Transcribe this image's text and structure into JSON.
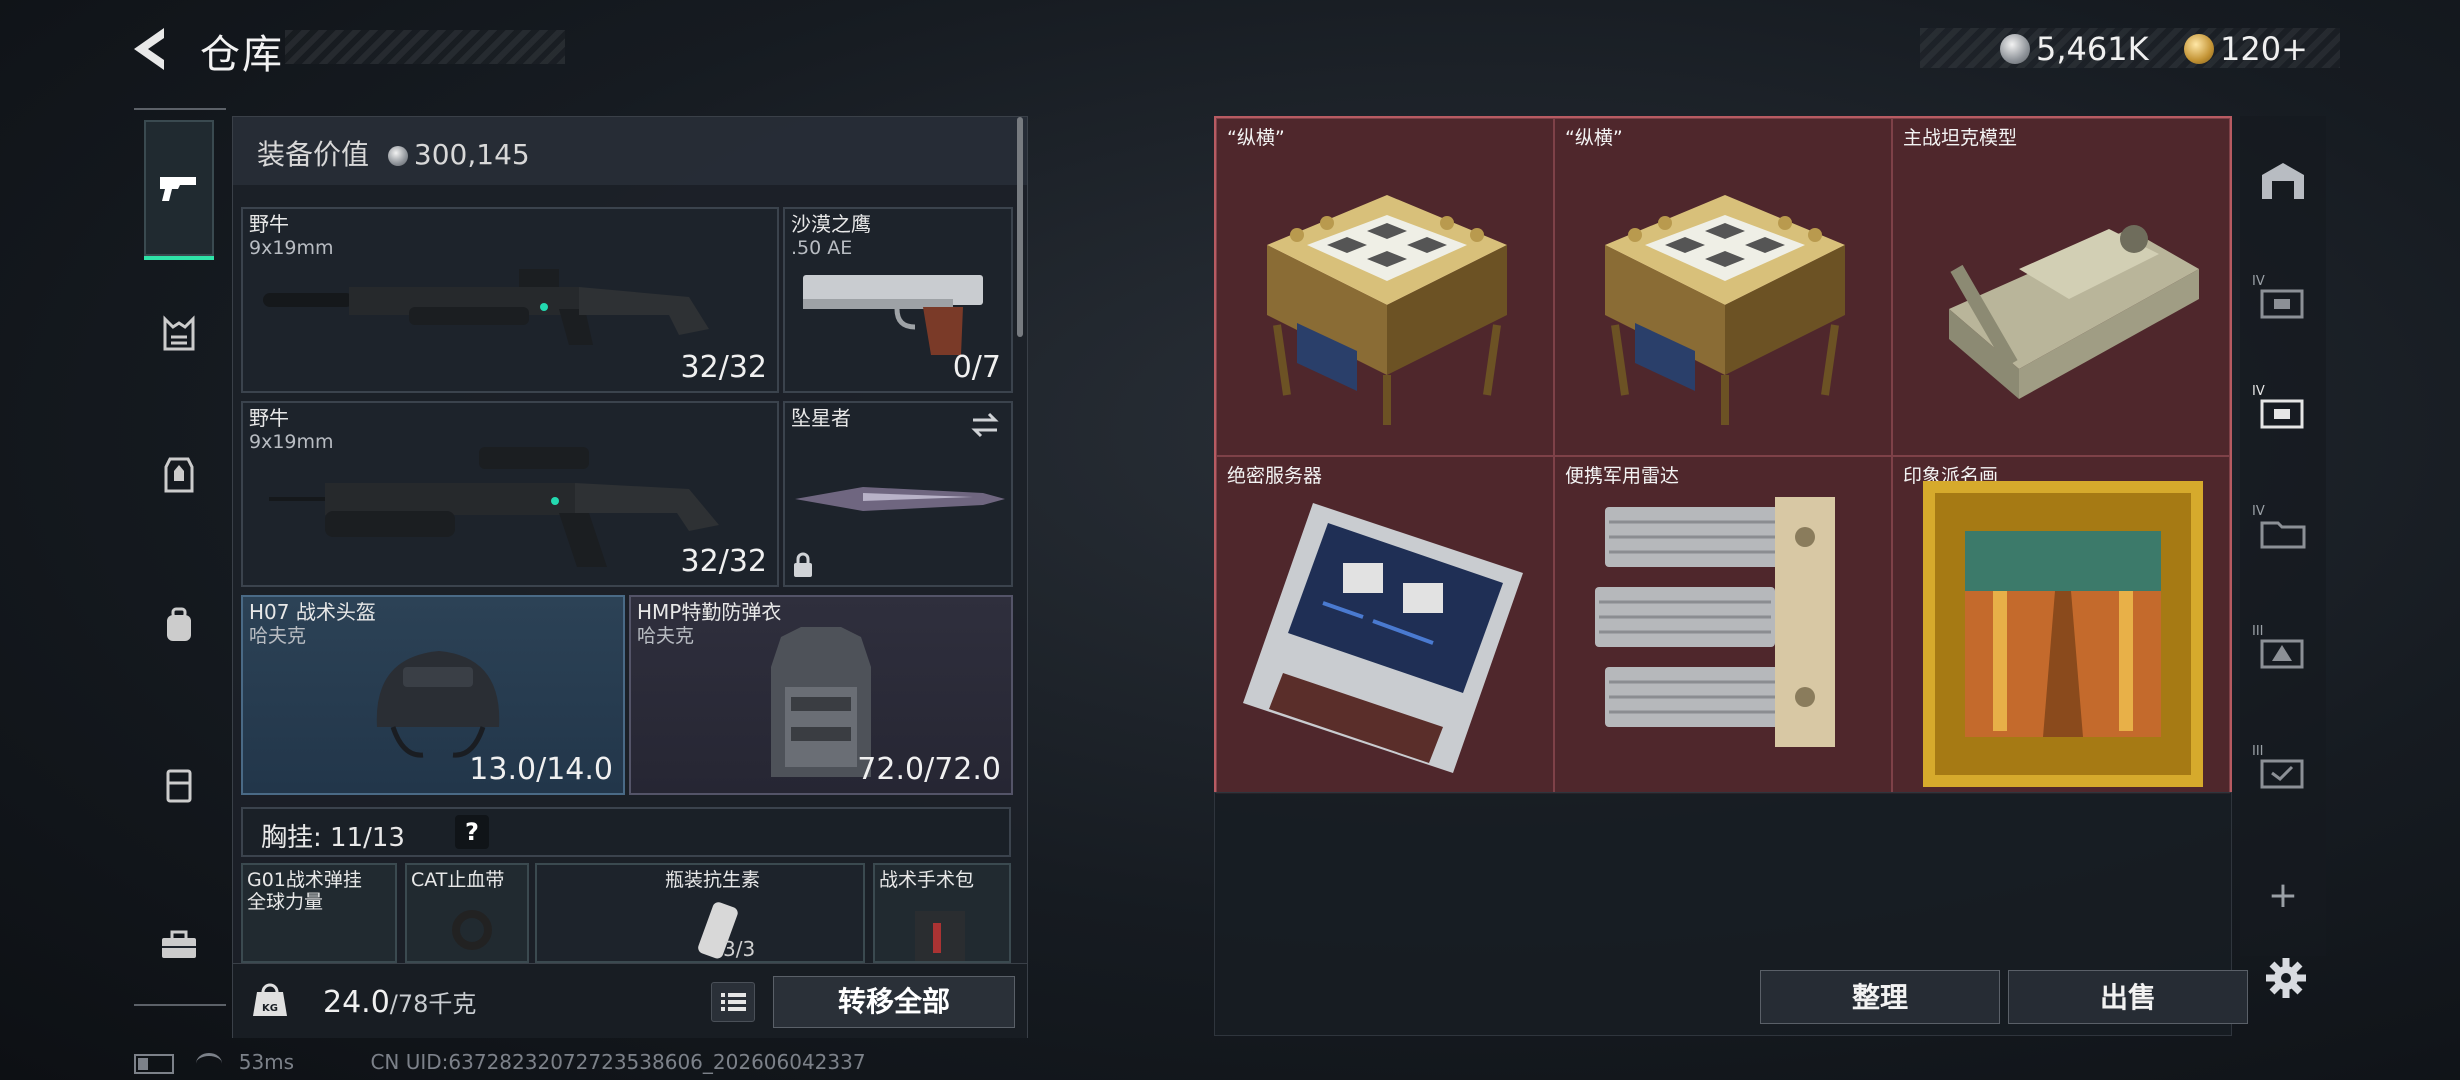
{
  "header": {
    "title": "仓库"
  },
  "currency": {
    "silver": "5,461K",
    "gold": "120+"
  },
  "equipment": {
    "value_label": "装备价值",
    "value": "300,145",
    "slots": [
      {
        "name": "野牛",
        "sub": "9x19mm",
        "count": "32/32"
      },
      {
        "name": "沙漠之鹰",
        "sub": ".50 AE",
        "count": "0/7"
      },
      {
        "name": "野牛",
        "sub": "9x19mm",
        "count": "32/32"
      },
      {
        "name": "坠星者",
        "sub": "",
        "count": ""
      },
      {
        "name": "H07 战术头盔",
        "sub": "哈夫克",
        "count": "13.0/14.0"
      },
      {
        "name": "HMP特勤防弹衣",
        "sub": "哈夫克",
        "count": "72.0/72.0"
      }
    ],
    "chest_label": "胸挂: 11/13",
    "chest_help": "?",
    "rig": [
      {
        "name": "G01战术弹挂",
        "sub": "全球力量"
      },
      {
        "name": "CAT止血带"
      },
      {
        "name": "瓶装抗生素",
        "count": "3/3"
      },
      {
        "name": "战术手术包"
      }
    ],
    "weight": "24.0",
    "weight_max": "/78千克",
    "transfer_all": "转移全部"
  },
  "storage": {
    "items": [
      {
        "name": "“纵横”",
        "icon": "chess-set"
      },
      {
        "name": "“纵横”",
        "icon": "chess-set"
      },
      {
        "name": "主战坦克模型",
        "icon": "tank-model"
      },
      {
        "name": "绝密服务器",
        "icon": "server"
      },
      {
        "name": "便携军用雷达",
        "icon": "radar"
      },
      {
        "name": "印象派名画",
        "icon": "painting"
      }
    ],
    "sort_button": "整理",
    "sell_button": "出售"
  },
  "right_rail": {
    "labels": [
      "IV",
      "IV",
      "IV",
      "III",
      "III"
    ],
    "add": "+"
  },
  "status": {
    "ping": "53ms",
    "uid": "CN UID:6372823207272353​8606_202606042337"
  }
}
